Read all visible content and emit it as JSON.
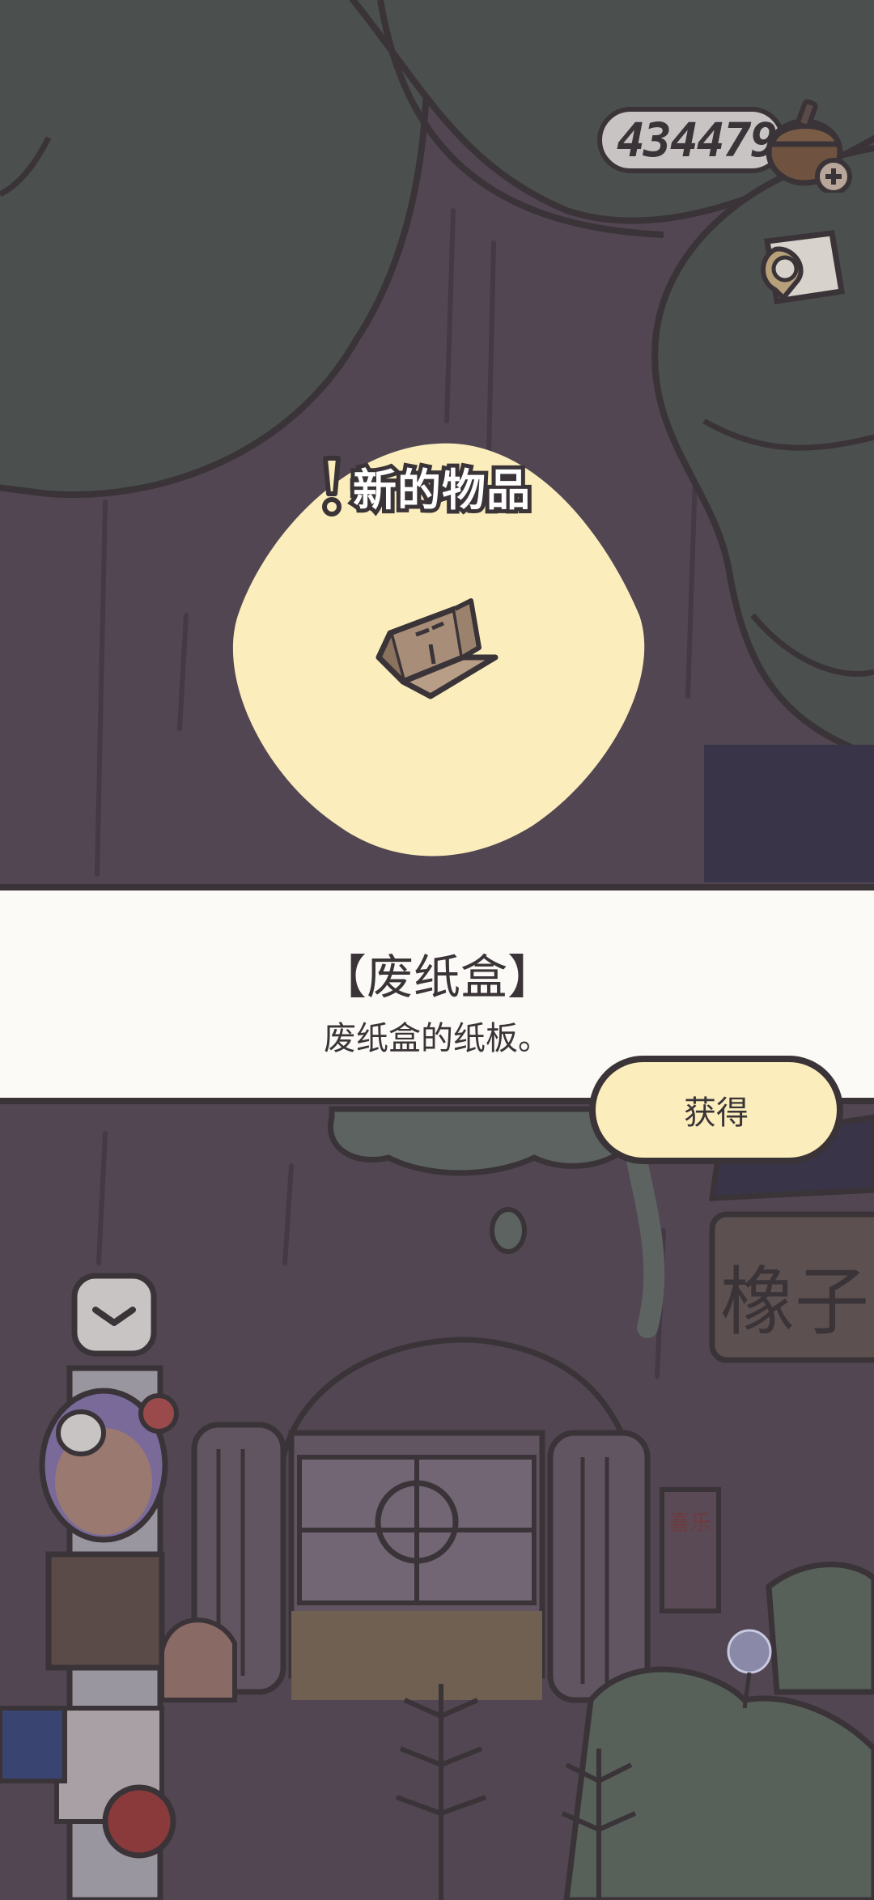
{
  "hud": {
    "acorn_count": "434479",
    "acorn_icon": "acorn-add-icon",
    "album_icon": "album-card-icon"
  },
  "new_item": {
    "header": "新的物品",
    "icon": "cardboard-box-icon"
  },
  "item_info": {
    "name": "【废纸盒】",
    "description": "废纸盒的纸板。"
  },
  "actions": {
    "obtain_label": "获得"
  },
  "scene": {
    "collapse_icon": "chevron-down-icon",
    "shop_sign_text": "橡子",
    "door_sign_text": "喜乐"
  },
  "colors": {
    "overlay_bg": "#514652",
    "canopy": "#4b4f4d",
    "glow": "#fbeebc",
    "panel": "#fcfaf6",
    "outline": "#3a3438"
  }
}
